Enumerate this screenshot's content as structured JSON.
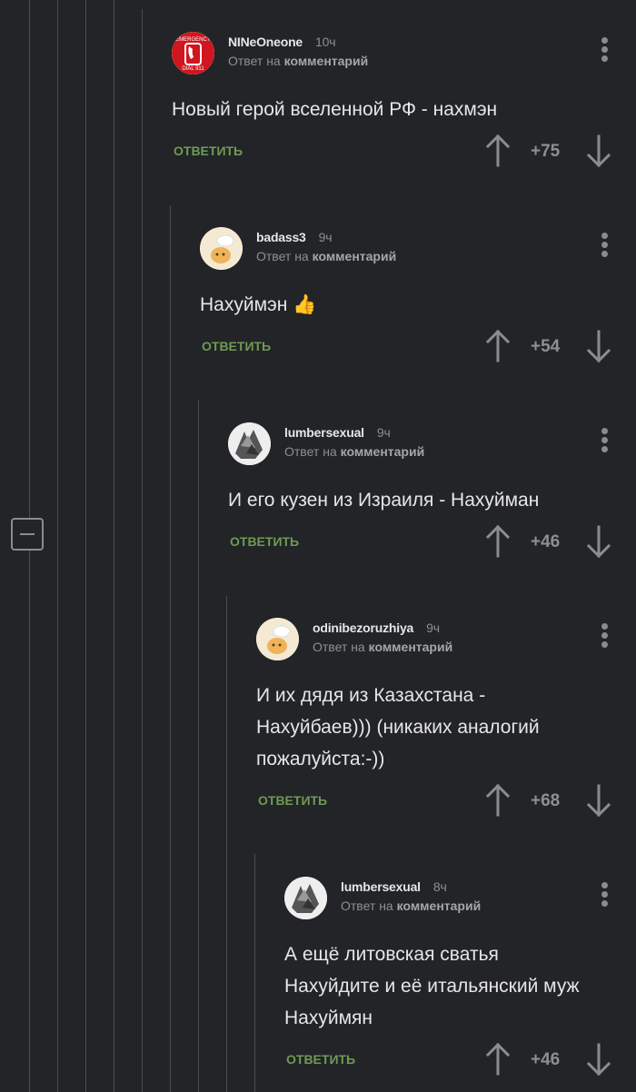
{
  "comments": [
    {
      "author": "NINeOneone",
      "time": "10ч",
      "reply_prefix": "Ответ на",
      "reply_target": "комментарий",
      "avatar_text_top": "EMERGENCY",
      "avatar_text_bottom": "DIAL 911",
      "lines": [
        "Новый герой вселенной РФ - нахмэн"
      ],
      "reply_label": "ОТВЕТИТЬ",
      "rating": "+75"
    },
    {
      "author": "badass3",
      "time": "9ч",
      "reply_prefix": "Ответ на",
      "reply_target": "комментарий",
      "lines": [
        "Нахуймэн 👍"
      ],
      "reply_label": "ОТВЕТИТЬ",
      "rating": "+54"
    },
    {
      "author": "lumbersexual",
      "time": "9ч",
      "reply_prefix": "Ответ на",
      "reply_target": "комментарий",
      "lines": [
        "И его кузен из Израиля - Нахуйман"
      ],
      "reply_label": "ОТВЕТИТЬ",
      "rating": "+46"
    },
    {
      "author": "odinibezoruzhiya",
      "time": "9ч",
      "reply_prefix": "Ответ на",
      "reply_target": "комментарий",
      "lines": [
        "И их дядя из Казахстана -",
        "Нахуйбаев))) (никаких аналогий",
        "пожалуйста:-))"
      ],
      "reply_label": "ОТВЕТИТЬ",
      "rating": "+68"
    },
    {
      "author": "lumbersexual",
      "time": "8ч",
      "reply_prefix": "Ответ на",
      "reply_target": "комментарий",
      "lines": [
        "А ещё литовская сватья",
        "Нахуйдите и её итальянский муж",
        "Нахуймян"
      ],
      "reply_label": "ОТВЕТИТЬ",
      "rating": "+46"
    }
  ],
  "colors": {
    "background": "#222427",
    "reply_link": "#6f9a55",
    "muted": "#8d8f92",
    "thread_line": "#4a4c50"
  }
}
